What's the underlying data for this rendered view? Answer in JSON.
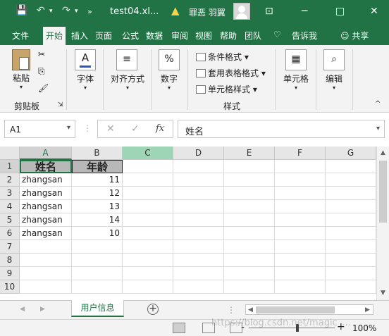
{
  "titlebar": {
    "filename": "test04.xl...",
    "warning_icon": "warning-icon",
    "user_name": "罪恶 羽翼",
    "minimize": "─",
    "maximize": "□",
    "close": "✕"
  },
  "tabs": [
    "文件",
    "开始",
    "插入",
    "页面",
    "公式",
    "数据",
    "审阅",
    "视图",
    "帮助",
    "团队",
    "告诉我",
    "共享"
  ],
  "ribbon": {
    "paste": "粘贴",
    "clipboard_group": "剪贴板",
    "font": "字体",
    "alignment": "对齐方式",
    "number": "数字",
    "conditional_format": "条件格式",
    "table_format": "套用表格格式",
    "cell_style": "单元格样式",
    "styles_group": "样式",
    "cells": "单元格",
    "editing": "编辑"
  },
  "formula_bar": {
    "name_box": "A1",
    "fx": "fx",
    "cancel": "✕",
    "enter": "✓",
    "value": "姓名"
  },
  "sheet": {
    "columns": [
      "A",
      "B",
      "C",
      "D",
      "E",
      "F",
      "G"
    ],
    "rows": [
      "1",
      "2",
      "3",
      "4",
      "5",
      "6",
      "7",
      "8",
      "9",
      "10"
    ],
    "header": [
      "姓名",
      "年龄"
    ],
    "data": [
      [
        "zhangsan",
        "11"
      ],
      [
        "zhangsan",
        "12"
      ],
      [
        "zhangsan",
        "13"
      ],
      [
        "zhangsan",
        "14"
      ],
      [
        "zhangsan",
        "10"
      ]
    ]
  },
  "sheet_tab": "用户信息",
  "status": {
    "zoom": "100%",
    "minus": "-",
    "plus": "+"
  },
  "watermark": "https://blog.csdn.net/magic_..."
}
